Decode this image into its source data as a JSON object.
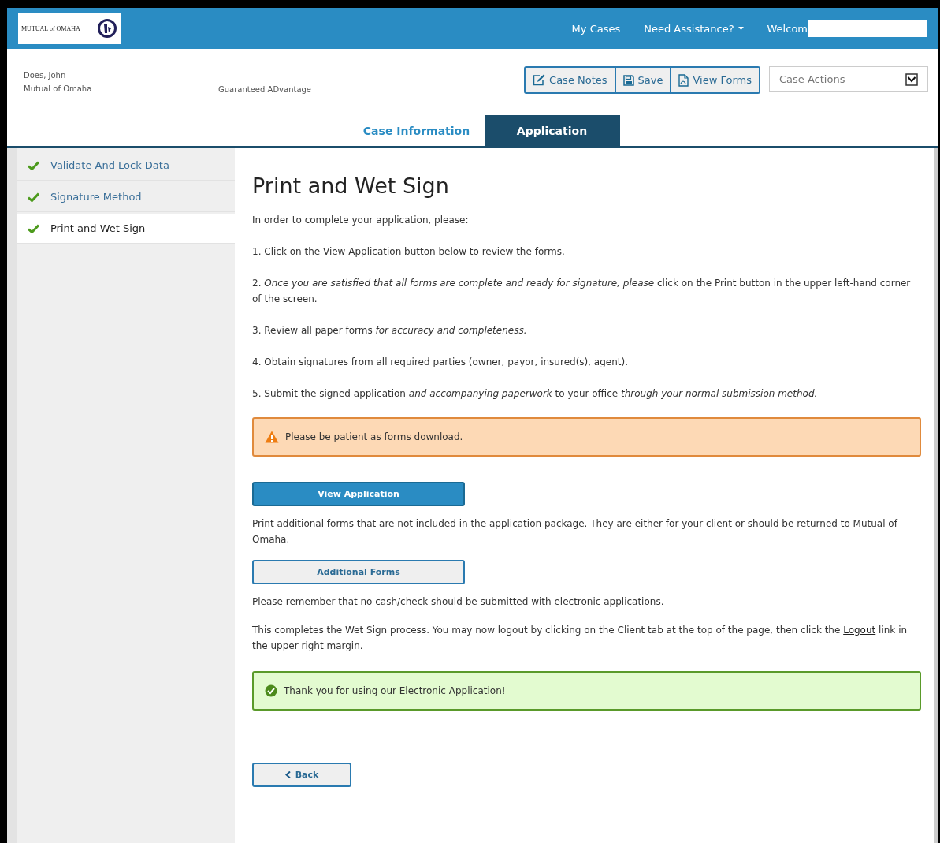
{
  "logo": {
    "text": "MUTUAL of OMAHA"
  },
  "top_nav": [
    {
      "label": "My Cases",
      "kind": "link"
    },
    {
      "label": "Need Assistance?",
      "kind": "dropdown"
    },
    {
      "label": "Welcom",
      "kind": "user"
    }
  ],
  "case_header": {
    "client": "Does, John",
    "company": "Mutual of Omaha",
    "product": "Guaranteed ADvantage"
  },
  "toolbar": [
    {
      "label": "Case Notes",
      "kind": "notes"
    },
    {
      "label": "Save",
      "kind": "save"
    },
    {
      "label": "View Forms",
      "kind": "forms"
    }
  ],
  "case_actions": {
    "placeholder": "Case Actions"
  },
  "tabs": [
    {
      "label": "Case Information",
      "selected": false
    },
    {
      "label": "Application",
      "selected": true
    }
  ],
  "steps": [
    {
      "label": "Validate And Lock Data",
      "checked": true,
      "selected": false
    },
    {
      "label": "Signature Method",
      "checked": true,
      "selected": false
    },
    {
      "label": "Print and Wet Sign",
      "checked": true,
      "selected": true
    }
  ],
  "content": {
    "title": "Print and Wet Sign",
    "intro": "In order to complete your application, please:",
    "instructions": [
      "1. Click on the View Application button below to review the forms.",
      "2. *Once you are satisfied that all forms are complete and ready for signature, please* click on the Print button in the upper left-hand corner of the screen.",
      "3. Review all paper forms *for accuracy and completeness.*",
      "4. Obtain signatures from all required parties (owner, payor, insured(s), agent).",
      "5. Submit the signed application *and accompanying paperwork* to your office *through your normal submission method.*"
    ],
    "warning": "Please be patient as forms download.",
    "view_button": "View Application",
    "additional_text": "Print additional forms that are not included in the application package. They are either for your client or should be returned to Mutual of Omaha.",
    "additional_button": "Additional Forms",
    "cash_note": "Please remember that no cash/check should be submitted with electronic applications.",
    "completion_before": "This completes the Wet Sign process. You may now logout by clicking on the Client tab at the top of the page, then click the",
    "completion_link": "Logout",
    "completion_after": "link in the upper right margin.",
    "success": "Thank you for using our Electronic Application!",
    "back_button": "Back"
  }
}
